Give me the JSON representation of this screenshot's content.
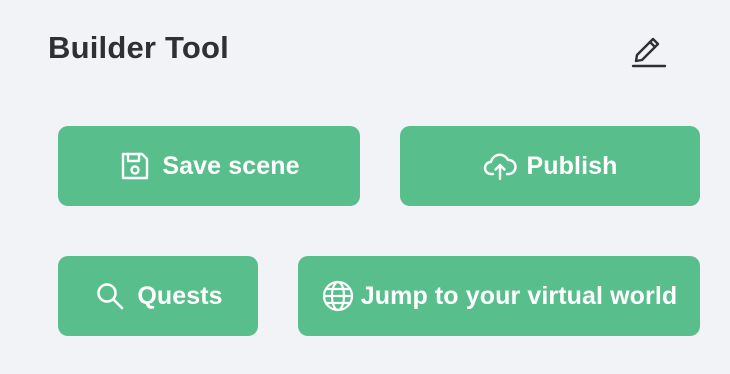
{
  "panel": {
    "title": "Builder Tool"
  },
  "header": {
    "edit_icon": "pencil-icon"
  },
  "actions": {
    "save": {
      "label": "Save scene",
      "icon": "save-icon"
    },
    "publish": {
      "label": "Publish",
      "icon": "cloud-upload-icon"
    },
    "quests": {
      "label": "Quests",
      "icon": "search-icon"
    },
    "jump": {
      "label": "Jump to your virtual world",
      "icon": "globe-icon"
    }
  },
  "colors": {
    "background": "#f2f3f7",
    "button": "#58be8c",
    "button_text": "#ffffff",
    "title_text": "#2e3034"
  }
}
